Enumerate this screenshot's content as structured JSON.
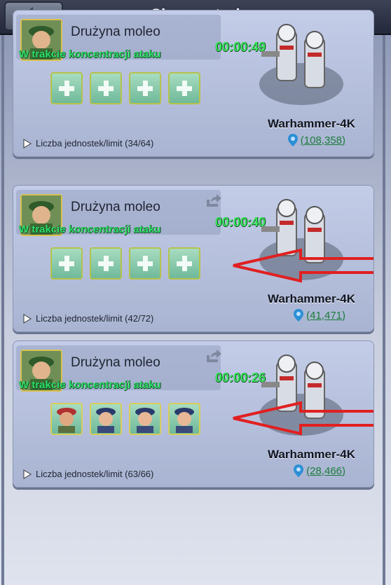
{
  "header": {
    "title": "Skoncentruj",
    "back_icon": "back-arrow-icon"
  },
  "cards": [
    {
      "team": "Drużyna moleo",
      "status": "W trakcie koncentracji ataku",
      "timer": "00:00:49",
      "slots": [
        "plus",
        "plus",
        "plus",
        "plus"
      ],
      "units_label": "Liczba jednostek/limit (34/64)",
      "enemy": "Warhammer-4K",
      "coords": "(108,358)",
      "arrow": false
    },
    {
      "team": "Drużyna moleo",
      "status": "W trakcie koncentracji ataku",
      "timer": "00:00:40",
      "slots": [
        "plus",
        "plus",
        "plus",
        "plus"
      ],
      "units_label": "Liczba jednostek/limit (42/72)",
      "enemy": "Warhammer-4K",
      "coords": "(41,471)",
      "arrow": true
    },
    {
      "team": "Drużyna moleo",
      "status": "W trakcie koncentracji ataku",
      "timer": "00:00:26",
      "slots": [
        "unit",
        "unit",
        "unit",
        "unit"
      ],
      "units_label": "Liczba jednostek/limit (63/66)",
      "enemy": "Warhammer-4K",
      "coords": "(28,466)",
      "arrow": true
    }
  ],
  "colors": {
    "status_green": "#2fe06a",
    "coords_green": "#1b7c3a",
    "arrow_red": "#e02020"
  }
}
